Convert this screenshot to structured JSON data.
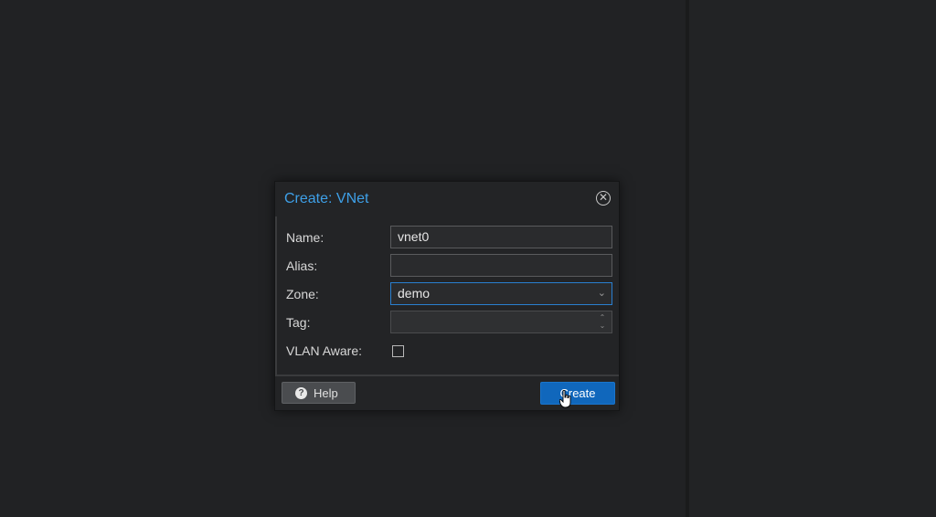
{
  "dialog": {
    "title": "Create: VNet",
    "close_icon": "close-icon",
    "fields": {
      "name": {
        "label": "Name:",
        "value": "vnet0"
      },
      "alias": {
        "label": "Alias:",
        "value": ""
      },
      "zone": {
        "label": "Zone:",
        "value": "demo"
      },
      "tag": {
        "label": "Tag:",
        "value": ""
      },
      "vlan_aware": {
        "label": "VLAN Aware:",
        "checked": false
      }
    },
    "buttons": {
      "help": "Help",
      "create": "Create"
    }
  },
  "colors": {
    "title": "#3ea0e8",
    "primary_button": "#1067bc",
    "focus_border": "#2a7fd0"
  }
}
